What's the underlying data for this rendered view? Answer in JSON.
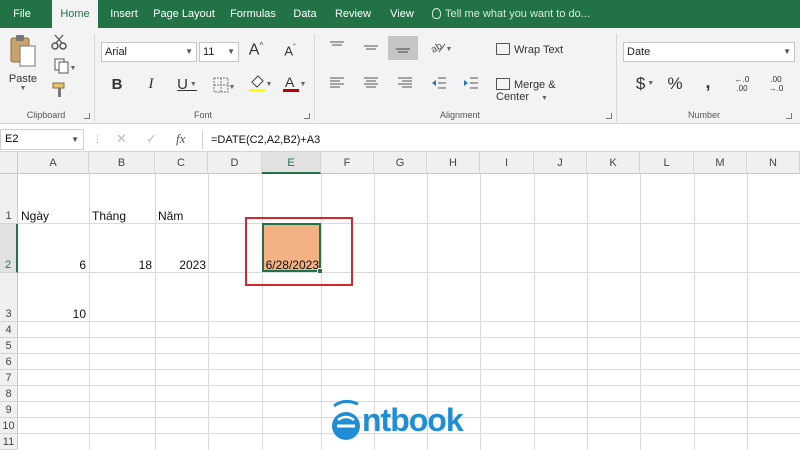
{
  "tabs": [
    "File",
    "Home",
    "Insert",
    "Page Layout",
    "Formulas",
    "Data",
    "Review",
    "View"
  ],
  "tell_me": "Tell me what you want to do...",
  "ribbon": {
    "clipboard": {
      "label": "Clipboard",
      "paste": "Paste"
    },
    "font": {
      "label": "Font",
      "font_name": "Arial",
      "font_size": "11"
    },
    "alignment": {
      "label": "Alignment",
      "wrap_text": "Wrap Text",
      "merge_center": "Merge & Center"
    },
    "number": {
      "label": "Number",
      "format": "Date"
    }
  },
  "formula_bar": {
    "name_box": "E2",
    "formula": "=DATE(C2,A2,B2)+A3"
  },
  "columns": [
    "A",
    "B",
    "C",
    "D",
    "E",
    "F",
    "G",
    "H",
    "I",
    "J",
    "K",
    "L",
    "M",
    "N"
  ],
  "rows": [
    "1",
    "2",
    "3",
    "4",
    "5",
    "6",
    "7",
    "8",
    "9",
    "10",
    "11"
  ],
  "cells": {
    "A1": "Ngày",
    "B1": "Tháng",
    "C1": "Năm",
    "A2": "6",
    "B2": "18",
    "C2": "2023",
    "E2": "6/28/2023",
    "A3": "10"
  },
  "selected_cell": "E2",
  "colors": {
    "excel_green": "#217346",
    "cell_fill": "#f4b183",
    "highlight_box": "#d9262c",
    "font_color_bar": "#c00000",
    "fill_color_bar": "#ffff00"
  },
  "watermark": {
    "text": "ntbook"
  }
}
